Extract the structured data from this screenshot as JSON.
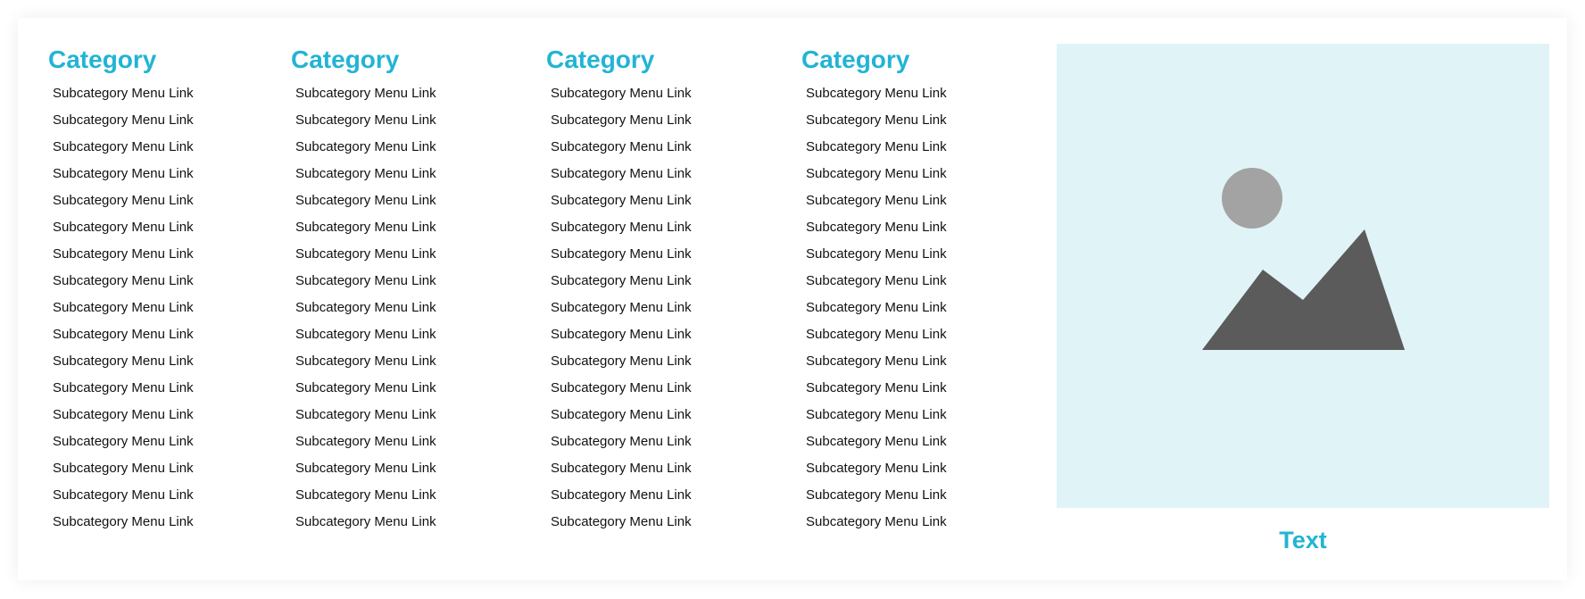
{
  "menu": {
    "accent_color": "#22b4d4",
    "columns": [
      {
        "title": "Category",
        "links": [
          "Subcategory Menu Link",
          "Subcategory Menu Link",
          "Subcategory Menu Link",
          "Subcategory Menu Link",
          "Subcategory Menu Link",
          "Subcategory Menu Link",
          "Subcategory Menu Link",
          "Subcategory Menu Link",
          "Subcategory Menu Link",
          "Subcategory Menu Link",
          "Subcategory Menu Link",
          "Subcategory Menu Link",
          "Subcategory Menu Link",
          "Subcategory Menu Link",
          "Subcategory Menu Link",
          "Subcategory Menu Link",
          "Subcategory Menu Link"
        ]
      },
      {
        "title": "Category",
        "links": [
          "Subcategory Menu Link",
          "Subcategory Menu Link",
          "Subcategory Menu Link",
          "Subcategory Menu Link",
          "Subcategory Menu Link",
          "Subcategory Menu Link",
          "Subcategory Menu Link",
          "Subcategory Menu Link",
          "Subcategory Menu Link",
          "Subcategory Menu Link",
          "Subcategory Menu Link",
          "Subcategory Menu Link",
          "Subcategory Menu Link",
          "Subcategory Menu Link",
          "Subcategory Menu Link",
          "Subcategory Menu Link",
          "Subcategory Menu Link"
        ]
      },
      {
        "title": "Category",
        "links": [
          "Subcategory Menu Link",
          "Subcategory Menu Link",
          "Subcategory Menu Link",
          "Subcategory Menu Link",
          "Subcategory Menu Link",
          "Subcategory Menu Link",
          "Subcategory Menu Link",
          "Subcategory Menu Link",
          "Subcategory Menu Link",
          "Subcategory Menu Link",
          "Subcategory Menu Link",
          "Subcategory Menu Link",
          "Subcategory Menu Link",
          "Subcategory Menu Link",
          "Subcategory Menu Link",
          "Subcategory Menu Link",
          "Subcategory Menu Link"
        ]
      },
      {
        "title": "Category",
        "links": [
          "Subcategory Menu Link",
          "Subcategory Menu Link",
          "Subcategory Menu Link",
          "Subcategory Menu Link",
          "Subcategory Menu Link",
          "Subcategory Menu Link",
          "Subcategory Menu Link",
          "Subcategory Menu Link",
          "Subcategory Menu Link",
          "Subcategory Menu Link",
          "Subcategory Menu Link",
          "Subcategory Menu Link",
          "Subcategory Menu Link",
          "Subcategory Menu Link",
          "Subcategory Menu Link",
          "Subcategory Menu Link",
          "Subcategory Menu Link"
        ]
      }
    ],
    "promo": {
      "image_icon": "image-placeholder-icon",
      "background_color": "#e0f4f8",
      "text": "Text"
    }
  }
}
